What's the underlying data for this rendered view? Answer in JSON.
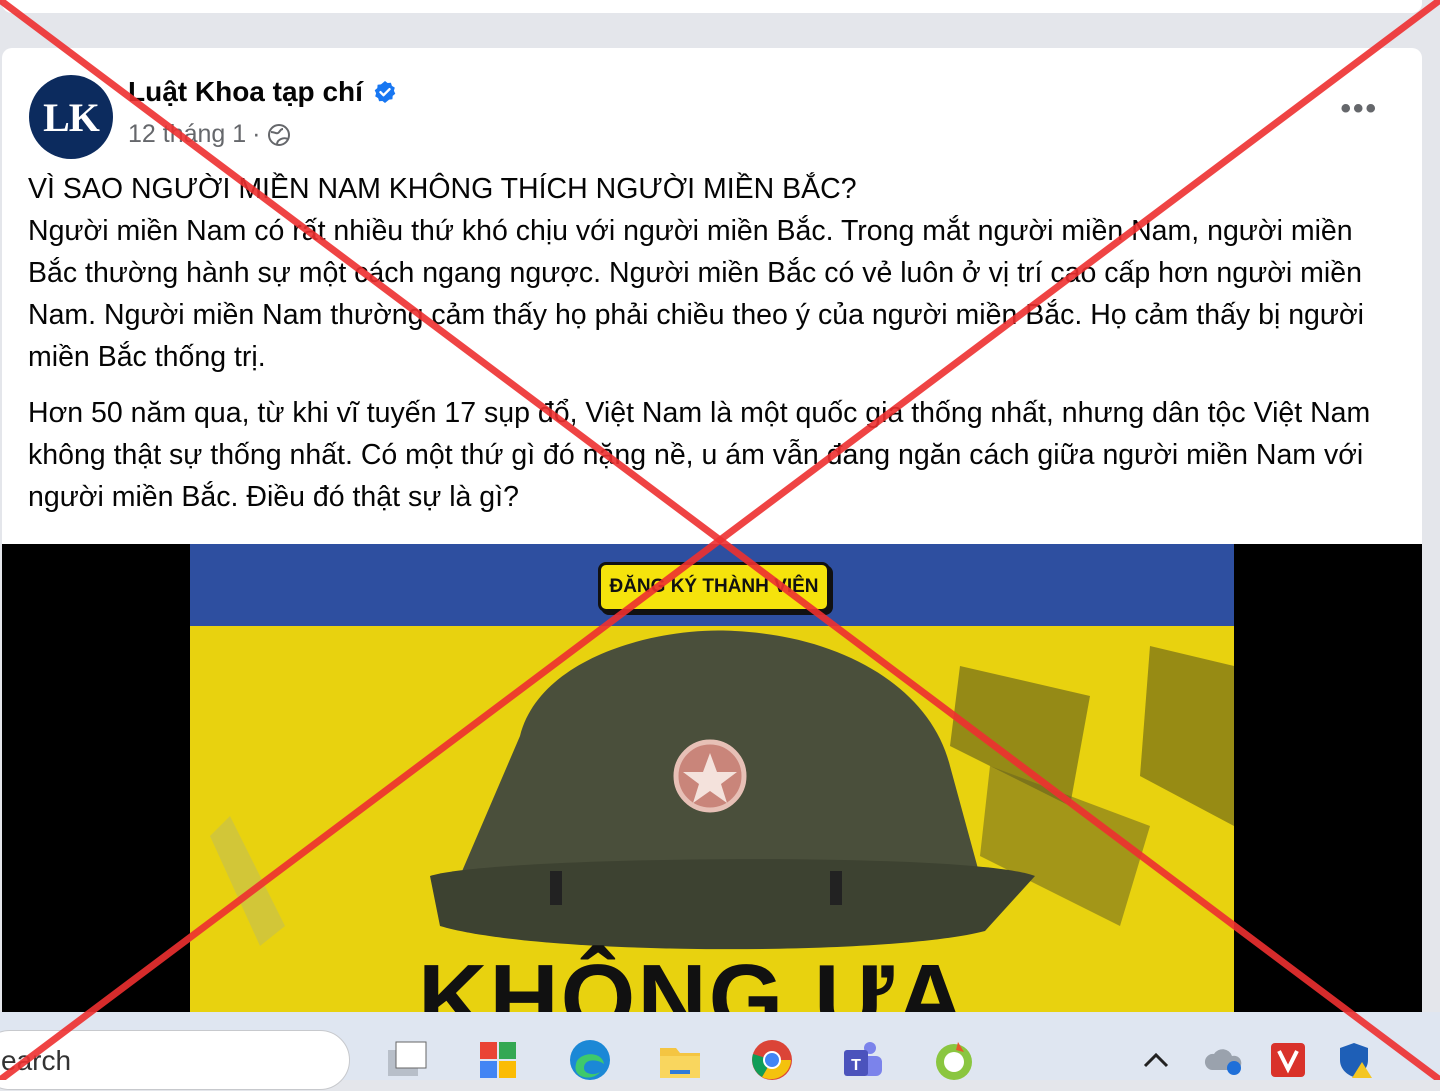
{
  "post": {
    "author": "Luật Khoa tạp chí",
    "avatar_initials": "LK",
    "date": "12 tháng 1",
    "separator": "·",
    "more_label": "•••",
    "paragraphs": [
      "VÌ SAO NGƯỜI MIỀN NAM KHÔNG THÍCH NGƯỜI MIỀN BẮC?\nNgười miền Nam có rất nhiều thứ khó chịu với người miền Bắc. Trong mắt người miền Nam, người miền Bắc thường hành sự một cách ngang ngược. Người miền Bắc có vẻ luôn ở vị trí cao cấp hơn người miền Nam. Người miền Nam thường cảm thấy họ phải chiều theo ý của người miền Bắc. Họ cảm thấy bị người miền Bắc thống trị.",
      "Hơn 50 năm qua, từ khi vĩ tuyến 17 sụp đổ, Việt Nam là một quốc gia thống nhất, nhưng dân tộc Việt Nam không thật sự thống nhất. Có một thứ gì đó nặng nề, u ám vẫn đang ngăn cách giữa người miền Nam với người miền Bắc. Điều đó thật sự là gì?"
    ],
    "image": {
      "button_label": "ĐĂNG KÝ THÀNH VIÊN",
      "headline": "KHÔNG ƯA"
    }
  },
  "taskbar": {
    "search_text": "earch",
    "apps": [
      "task-view-icon",
      "start-icon",
      "edge-icon",
      "file-explorer-icon",
      "chrome-icon",
      "teams-icon",
      "coccoc-icon"
    ],
    "tray": [
      "chevron-up-icon",
      "onedrive-icon",
      "vivaldi-icon",
      "security-icon"
    ]
  },
  "colors": {
    "cross": "#ee3030",
    "accent": "#1877f2",
    "thumb_yellow": "#e8d20f"
  }
}
